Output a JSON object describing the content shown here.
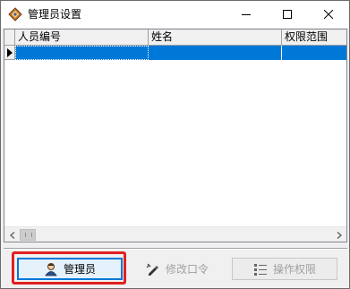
{
  "window": {
    "title": "管理员设置",
    "icons": {
      "app": "app-logo-icon",
      "minimize": "minimize-icon",
      "maximize": "maximize-icon",
      "close": "close-icon"
    }
  },
  "grid": {
    "columns": [
      "人员编号",
      "姓名",
      "权限范围"
    ],
    "rows": [
      {
        "cells": [
          "",
          "",
          ""
        ],
        "selected": true
      }
    ],
    "selection_color": "#0078d7"
  },
  "buttons": {
    "admin": {
      "label": "管理员",
      "icon": "user-icon",
      "enabled": true
    },
    "change_password": {
      "label": "修改口令",
      "icon": "edit-pen-icon",
      "enabled": false
    },
    "permissions": {
      "label": "操作权限",
      "icon": "list-icon",
      "enabled": false
    }
  },
  "highlight_color": "#e02020"
}
